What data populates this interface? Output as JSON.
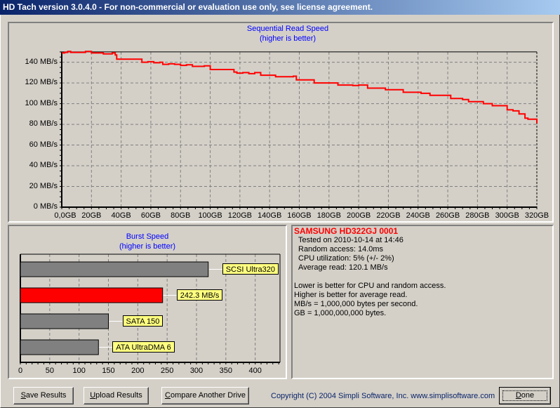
{
  "window": {
    "title": "HD Tach version 3.0.4.0  - For non-commercial or evaluation use only, see license agreement."
  },
  "colors": {
    "line": "#ff0000",
    "drive_bar": "#ff0000",
    "reference_bar": "#808080",
    "label_bg": "#ffff80",
    "chart_title": "#0000ff",
    "drive_name": "#ff0000"
  },
  "chart_data": [
    {
      "type": "line",
      "title": "Sequential Read Speed",
      "subtitle": "(higher is better)",
      "xlabel": "",
      "ylabel": "",
      "xlim": [
        0,
        320
      ],
      "ylim": [
        0,
        150
      ],
      "grid": true,
      "y_ticks": [
        0,
        20,
        40,
        60,
        80,
        100,
        120,
        140
      ],
      "y_tick_labels": [
        "0 MB/s",
        "20 MB/s",
        "40 MB/s",
        "60 MB/s",
        "80 MB/s",
        "100 MB/s",
        "120 MB/s",
        "140 MB/s"
      ],
      "x_ticks": [
        0,
        20,
        40,
        60,
        80,
        100,
        120,
        140,
        160,
        180,
        200,
        220,
        240,
        260,
        280,
        300,
        320
      ],
      "x_tick_labels": [
        "0,0GB",
        "20GB",
        "40GB",
        "60GB",
        "80GB",
        "100GB",
        "120GB",
        "140GB",
        "160GB",
        "180GB",
        "200GB",
        "220GB",
        "240GB",
        "260GB",
        "280GB",
        "300GB",
        "320GB"
      ],
      "series": [
        {
          "name": "Read speed",
          "x": [
            0,
            2,
            4,
            6,
            10,
            14,
            16,
            20,
            22,
            28,
            32,
            34,
            36,
            37,
            40,
            52,
            54,
            58,
            62,
            66,
            68,
            72,
            76,
            80,
            84,
            88,
            92,
            96,
            100,
            110,
            116,
            118,
            122,
            126,
            130,
            134,
            140,
            144,
            150,
            156,
            158,
            166,
            170,
            172,
            180,
            186,
            190,
            196,
            200,
            206,
            212,
            218,
            224,
            230,
            236,
            242,
            248,
            256,
            262,
            270,
            274,
            280,
            284,
            290,
            294,
            300,
            304,
            308,
            312,
            314,
            320
          ],
          "y": [
            149,
            149.5,
            150.5,
            149.5,
            149.5,
            149.5,
            150.5,
            149,
            149,
            148,
            148,
            149,
            147,
            143,
            143,
            143,
            140,
            140.5,
            139.5,
            140,
            138,
            138.5,
            138,
            137,
            137.5,
            136,
            136,
            136.5,
            133,
            133,
            130.5,
            129.5,
            130,
            129,
            130,
            127.5,
            127.5,
            126,
            126,
            126.5,
            123,
            123,
            120,
            120,
            120,
            118,
            118,
            117.5,
            118,
            115,
            115,
            113.5,
            113.5,
            111,
            111,
            110,
            108,
            108,
            105,
            104,
            102,
            102,
            100,
            98,
            98,
            94,
            93,
            90,
            86,
            85,
            81,
            80,
            76,
            76
          ]
        }
      ]
    },
    {
      "type": "bar",
      "orientation": "horizontal",
      "title": "Burst Speed",
      "subtitle": "(higher is better)",
      "xlim": [
        0,
        440
      ],
      "x_ticks": [
        0,
        50,
        100,
        150,
        200,
        250,
        300,
        350,
        400
      ],
      "x_tick_labels": [
        "0",
        "50",
        "100",
        "150",
        "200",
        "250",
        "300",
        "350",
        "400"
      ],
      "grid": true,
      "categories": [
        "SCSI Ultra320",
        "242.3 MB/s",
        "SATA 150",
        "ATA UltraDMA 6"
      ],
      "values": [
        320,
        242.3,
        150,
        133
      ],
      "highlight": [
        false,
        true,
        false,
        false
      ]
    }
  ],
  "info": {
    "drive_name": "SAMSUNG HD322GJ 0001",
    "tested_on": "Tested on 2010-10-14 at 14:46",
    "random_access": "Random access: 14.0ms",
    "cpu_utilization": "CPU utilization: 5% (+/- 2%)",
    "average_read": "Average read: 120.1 MB/s",
    "note1": "Lower is better for CPU and random access.",
    "note2": "Higher is better for average read.",
    "note3": "MB/s = 1,000,000 bytes per second.",
    "note4": "GB = 1,000,000,000 bytes."
  },
  "footer": {
    "save_prefix": "S",
    "save_rest": "ave Results",
    "upload_prefix": "U",
    "upload_rest": "pload Results",
    "compare_prefix": "C",
    "compare_rest": "ompare Another Drive",
    "copyright": "Copyright (C) 2004 Simpli Software, Inc. www.simplisoftware.com",
    "done_prefix": "D",
    "done_rest": "one"
  }
}
